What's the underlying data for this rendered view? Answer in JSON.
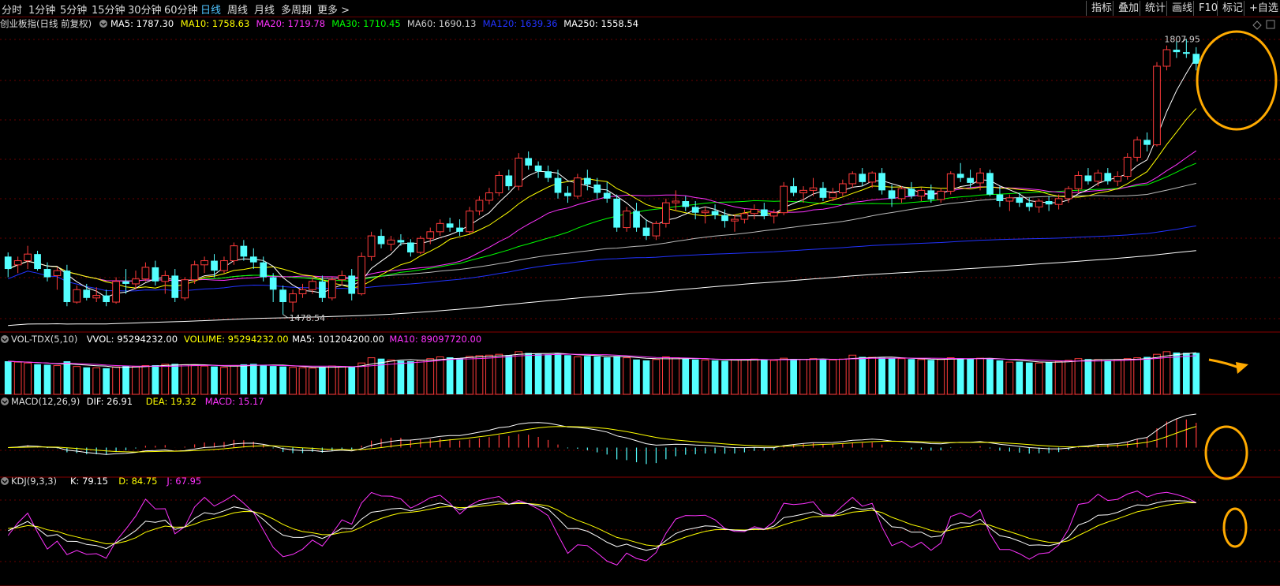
{
  "toolbar": {
    "periods": [
      "分时",
      "1分钟",
      "5分钟",
      "15分钟",
      "30分钟",
      "60分钟",
      "日线",
      "周线",
      "月线",
      "多周期",
      "更多 >"
    ],
    "active_period": "日线",
    "right_buttons": [
      "指标",
      "叠加",
      "统计",
      "画线",
      "F10",
      "标记",
      "+自选"
    ]
  },
  "colors": {
    "up": "#ff3b3b",
    "down": "#54ffff",
    "ma5": "#ffffff",
    "ma10": "#ffff00",
    "ma20": "#ff33ff",
    "ma30": "#00ff00",
    "ma60": "#bbbbbb",
    "ma120": "#2233ff",
    "ma250": "#ffffff",
    "highlight": "#ffaa00"
  },
  "price_panel": {
    "title": "创业板指(日线 前复权)",
    "ma_labels": [
      {
        "text": "MA5: 1787.30",
        "color": "#ffffff"
      },
      {
        "text": "MA10: 1758.63",
        "color": "#ffff00"
      },
      {
        "text": "MA20: 1719.78",
        "color": "#ff33ff"
      },
      {
        "text": "MA30: 1710.45",
        "color": "#00ff00"
      },
      {
        "text": "MA60: 1690.13",
        "color": "#cccccc"
      },
      {
        "text": "MA120: 1639.36",
        "color": "#2233ff"
      },
      {
        "text": "MA250: 1558.54",
        "color": "#ffffff"
      }
    ],
    "high_label": "1807.95",
    "low_label": "1478.54"
  },
  "volume_panel": {
    "labels": [
      {
        "text": "VOL-TDX(5,10)",
        "color": "#dddddd"
      },
      {
        "text": "VVOL: 95294232.00",
        "color": "#ffffff"
      },
      {
        "text": "VOLUME: 95294232.00",
        "color": "#ffff00"
      },
      {
        "text": "MA5: 101204200.00",
        "color": "#ffffff"
      },
      {
        "text": "MA10: 89097720.00",
        "color": "#ff33ff"
      }
    ]
  },
  "macd_panel": {
    "labels": [
      {
        "text": "MACD(12,26,9)",
        "color": "#dddddd"
      },
      {
        "text": "DIF: 26.91",
        "color": "#ffffff"
      },
      {
        "text": "DEA: 19.32",
        "color": "#ffff00"
      },
      {
        "text": "MACD: 15.17",
        "color": "#ff33ff"
      }
    ]
  },
  "kdj_panel": {
    "labels": [
      {
        "text": "KDJ(9,3,3)",
        "color": "#dddddd"
      },
      {
        "text": "K: 79.15",
        "color": "#ffffff"
      },
      {
        "text": "D: 84.75",
        "color": "#ffff00"
      },
      {
        "text": "J: 67.95",
        "color": "#ff33ff"
      }
    ]
  },
  "chart_data": {
    "type": "candlestick",
    "title": "创业板指(日线 前复权)",
    "ylim": [
      1470,
      1815
    ],
    "y_max_mark": 1807.95,
    "y_min_mark": 1478.54,
    "ohlc": [
      [
        1545,
        1550,
        1520,
        1530
      ],
      [
        1535,
        1545,
        1525,
        1540
      ],
      [
        1540,
        1558,
        1530,
        1548
      ],
      [
        1548,
        1552,
        1528,
        1530
      ],
      [
        1530,
        1538,
        1515,
        1520
      ],
      [
        1522,
        1532,
        1505,
        1528
      ],
      [
        1528,
        1535,
        1485,
        1490
      ],
      [
        1490,
        1510,
        1488,
        1505
      ],
      [
        1505,
        1512,
        1492,
        1495
      ],
      [
        1495,
        1508,
        1490,
        1498
      ],
      [
        1498,
        1505,
        1485,
        1490
      ],
      [
        1490,
        1520,
        1488,
        1515
      ],
      [
        1515,
        1530,
        1500,
        1512
      ],
      [
        1512,
        1528,
        1505,
        1518
      ],
      [
        1518,
        1538,
        1515,
        1532
      ],
      [
        1532,
        1540,
        1510,
        1515
      ],
      [
        1515,
        1528,
        1500,
        1522
      ],
      [
        1522,
        1530,
        1490,
        1495
      ],
      [
        1495,
        1520,
        1492,
        1517
      ],
      [
        1517,
        1540,
        1512,
        1535
      ],
      [
        1535,
        1545,
        1525,
        1540
      ],
      [
        1540,
        1548,
        1520,
        1528
      ],
      [
        1528,
        1545,
        1525,
        1540
      ],
      [
        1540,
        1562,
        1535,
        1558
      ],
      [
        1558,
        1565,
        1540,
        1545
      ],
      [
        1545,
        1555,
        1530,
        1538
      ],
      [
        1538,
        1545,
        1515,
        1520
      ],
      [
        1520,
        1525,
        1490,
        1505
      ],
      [
        1505,
        1510,
        1475,
        1490
      ],
      [
        1490,
        1505,
        1478,
        1500
      ],
      [
        1500,
        1512,
        1495,
        1505
      ],
      [
        1505,
        1520,
        1500,
        1515
      ],
      [
        1515,
        1522,
        1490,
        1495
      ],
      [
        1495,
        1520,
        1492,
        1517
      ],
      [
        1517,
        1528,
        1510,
        1522
      ],
      [
        1522,
        1530,
        1492,
        1500
      ],
      [
        1500,
        1550,
        1498,
        1545
      ],
      [
        1545,
        1575,
        1540,
        1570
      ],
      [
        1570,
        1578,
        1555,
        1560
      ],
      [
        1560,
        1570,
        1552,
        1565
      ],
      [
        1565,
        1572,
        1558,
        1562
      ],
      [
        1562,
        1566,
        1545,
        1550
      ],
      [
        1550,
        1570,
        1548,
        1567
      ],
      [
        1567,
        1580,
        1560,
        1575
      ],
      [
        1575,
        1590,
        1570,
        1585
      ],
      [
        1585,
        1592,
        1575,
        1580
      ],
      [
        1580,
        1590,
        1570,
        1575
      ],
      [
        1575,
        1605,
        1572,
        1600
      ],
      [
        1600,
        1618,
        1595,
        1613
      ],
      [
        1613,
        1628,
        1608,
        1622
      ],
      [
        1622,
        1648,
        1618,
        1643
      ],
      [
        1643,
        1650,
        1625,
        1630
      ],
      [
        1630,
        1670,
        1625,
        1664
      ],
      [
        1664,
        1672,
        1650,
        1655
      ],
      [
        1655,
        1660,
        1640,
        1648
      ],
      [
        1648,
        1655,
        1635,
        1640
      ],
      [
        1640,
        1650,
        1615,
        1622
      ],
      [
        1622,
        1630,
        1610,
        1618
      ],
      [
        1618,
        1645,
        1615,
        1640
      ],
      [
        1640,
        1650,
        1625,
        1632
      ],
      [
        1632,
        1640,
        1615,
        1622
      ],
      [
        1622,
        1635,
        1610,
        1615
      ],
      [
        1615,
        1620,
        1575,
        1580
      ],
      [
        1580,
        1605,
        1575,
        1600
      ],
      [
        1600,
        1610,
        1575,
        1580
      ],
      [
        1580,
        1590,
        1565,
        1570
      ],
      [
        1570,
        1588,
        1565,
        1585
      ],
      [
        1585,
        1615,
        1580,
        1610
      ],
      [
        1610,
        1625,
        1600,
        1612
      ],
      [
        1612,
        1618,
        1600,
        1605
      ],
      [
        1605,
        1612,
        1590,
        1598
      ],
      [
        1598,
        1605,
        1585,
        1600
      ],
      [
        1600,
        1608,
        1590,
        1595
      ],
      [
        1595,
        1602,
        1580,
        1588
      ],
      [
        1588,
        1596,
        1575,
        1590
      ],
      [
        1590,
        1602,
        1585,
        1597
      ],
      [
        1597,
        1608,
        1590,
        1602
      ],
      [
        1602,
        1610,
        1590,
        1594
      ],
      [
        1594,
        1602,
        1585,
        1598
      ],
      [
        1598,
        1635,
        1595,
        1630
      ],
      [
        1630,
        1640,
        1618,
        1622
      ],
      [
        1622,
        1630,
        1610,
        1625
      ],
      [
        1625,
        1640,
        1618,
        1628
      ],
      [
        1628,
        1635,
        1612,
        1616
      ],
      [
        1616,
        1628,
        1612,
        1622
      ],
      [
        1622,
        1638,
        1618,
        1633
      ],
      [
        1633,
        1648,
        1628,
        1645
      ],
      [
        1645,
        1652,
        1630,
        1635
      ],
      [
        1635,
        1648,
        1628,
        1646
      ],
      [
        1646,
        1652,
        1620,
        1625
      ],
      [
        1625,
        1632,
        1605,
        1615
      ],
      [
        1615,
        1630,
        1610,
        1627
      ],
      [
        1627,
        1635,
        1615,
        1618
      ],
      [
        1618,
        1628,
        1612,
        1625
      ],
      [
        1625,
        1632,
        1610,
        1614
      ],
      [
        1614,
        1628,
        1610,
        1624
      ],
      [
        1624,
        1648,
        1620,
        1645
      ],
      [
        1645,
        1658,
        1635,
        1640
      ],
      [
        1640,
        1650,
        1628,
        1634
      ],
      [
        1634,
        1652,
        1625,
        1646
      ],
      [
        1646,
        1650,
        1618,
        1620
      ],
      [
        1620,
        1630,
        1605,
        1612
      ],
      [
        1612,
        1620,
        1600,
        1616
      ],
      [
        1616,
        1622,
        1605,
        1610
      ],
      [
        1610,
        1616,
        1600,
        1605
      ],
      [
        1605,
        1615,
        1598,
        1612
      ],
      [
        1612,
        1618,
        1600,
        1608
      ],
      [
        1608,
        1620,
        1602,
        1615
      ],
      [
        1615,
        1630,
        1610,
        1627
      ],
      [
        1627,
        1648,
        1622,
        1643
      ],
      [
        1643,
        1652,
        1632,
        1636
      ],
      [
        1636,
        1650,
        1630,
        1646
      ],
      [
        1646,
        1652,
        1632,
        1636
      ],
      [
        1636,
        1648,
        1630,
        1642
      ],
      [
        1642,
        1670,
        1638,
        1665
      ],
      [
        1665,
        1690,
        1660,
        1686
      ],
      [
        1686,
        1695,
        1672,
        1680
      ],
      [
        1680,
        1780,
        1678,
        1775
      ],
      [
        1775,
        1800,
        1770,
        1795
      ],
      [
        1795,
        1805,
        1785,
        1792
      ],
      [
        1792,
        1807.95,
        1785,
        1790
      ],
      [
        1790,
        1798,
        1770,
        1778
      ]
    ],
    "volume": [
      76000000.0,
      74000000.0,
      72000000.0,
      69000000.0,
      68000000.0,
      66000000.0,
      76000000.0,
      64000000.0,
      62000000.0,
      61000000.0,
      60000000.0,
      63000000.0,
      65000000.0,
      64000000.0,
      66000000.0,
      67000000.0,
      69000000.0,
      70000000.0,
      68000000.0,
      67000000.0,
      65000000.0,
      64000000.0,
      62000000.0,
      66000000.0,
      69000000.0,
      70000000.0,
      68000000.0,
      65000000.0,
      64000000.0,
      62000000.0,
      61000000.0,
      60000000.0,
      63000000.0,
      65000000.0,
      64000000.0,
      63000000.0,
      72000000.0,
      84000000.0,
      82000000.0,
      79000000.0,
      77000000.0,
      76000000.0,
      78000000.0,
      82000000.0,
      86000000.0,
      85000000.0,
      83000000.0,
      87000000.0,
      89000000.0,
      90000000.0,
      92000000.0,
      90000000.0,
      98000000.0,
      95000000.0,
      93000000.0,
      92000000.0,
      94000000.0,
      90000000.0,
      86000000.0,
      88000000.0,
      87000000.0,
      85000000.0,
      88000000.0,
      84000000.0,
      80000000.0,
      78000000.0,
      80000000.0,
      86000000.0,
      84000000.0,
      82000000.0,
      80000000.0,
      79000000.0,
      78000000.0,
      77000000.0,
      79000000.0,
      80000000.0,
      81000000.0,
      80000000.0,
      78000000.0,
      83000000.0,
      81000000.0,
      80000000.0,
      82000000.0,
      80000000.0,
      79000000.0,
      81000000.0,
      90000000.0,
      86000000.0,
      85000000.0,
      84000000.0,
      83000000.0,
      82000000.0,
      81000000.0,
      80000000.0,
      79000000.0,
      80000000.0,
      84000000.0,
      83000000.0,
      82000000.0,
      83000000.0,
      82000000.0,
      78000000.0,
      74000000.0,
      75000000.0,
      73000000.0,
      72000000.0,
      74000000.0,
      76000000.0,
      78000000.0,
      82000000.0,
      81000000.0,
      80000000.0,
      78000000.0,
      80000000.0,
      82000000.0,
      84000000.0,
      86000000.0,
      92000000.0,
      98000000.0,
      96000000.0,
      95300000.0,
      95300000.0
    ]
  }
}
